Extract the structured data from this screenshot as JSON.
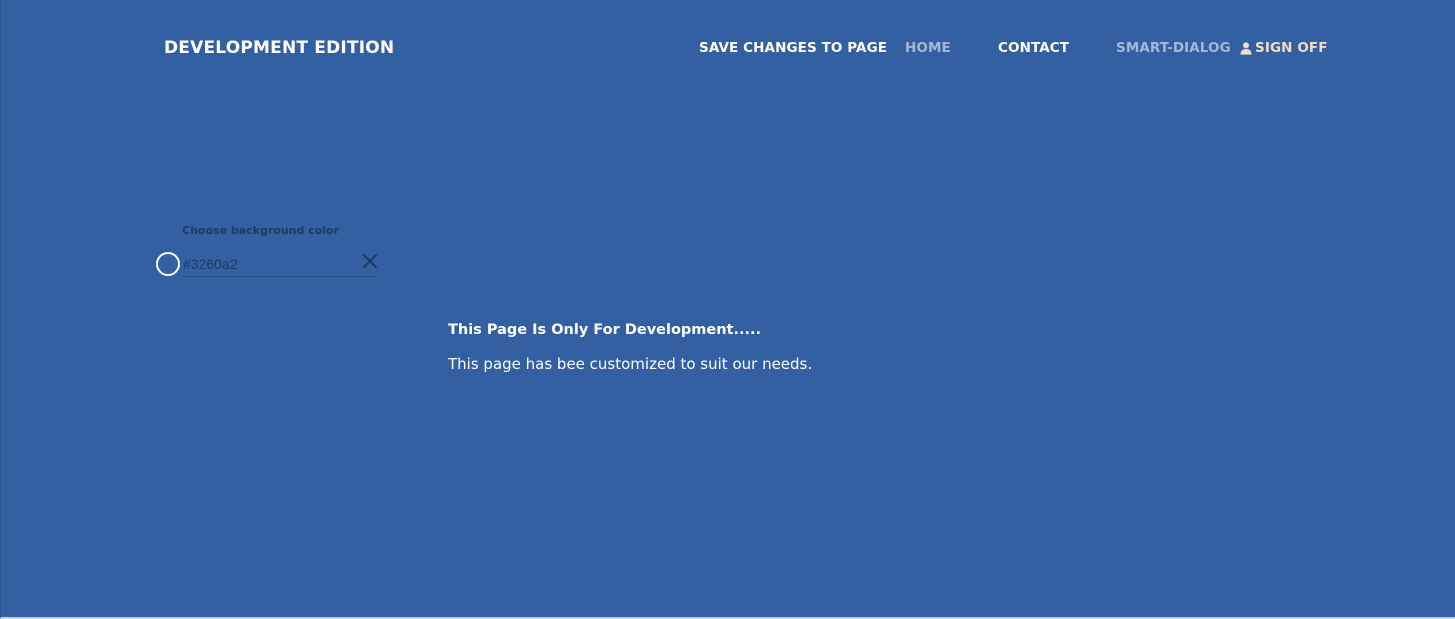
{
  "brand": {
    "title": "DEVELOPMENT EDITION"
  },
  "nav": {
    "save": "SAVE CHANGES TO PAGE",
    "home": "HOME",
    "contact": "CONTACT",
    "smart_dialog": "SMART-DIALOG",
    "sign_off": "SIGN OFF",
    "sign_off_icon": "user-icon"
  },
  "color_picker": {
    "label": "Choose background color",
    "value": "#3260a2",
    "swatch_color": "#3260a2",
    "clear_icon": "close-icon"
  },
  "content": {
    "heading": "This Page Is Only For Development.....",
    "body": "This page has bee customized to suit our needs."
  },
  "colors": {
    "background": "#3260a2",
    "nav_active": "#ffffff",
    "nav_muted": "#a7b8d6",
    "sign_off": "#f3dcc0",
    "dark_text": "#1d3a63"
  }
}
